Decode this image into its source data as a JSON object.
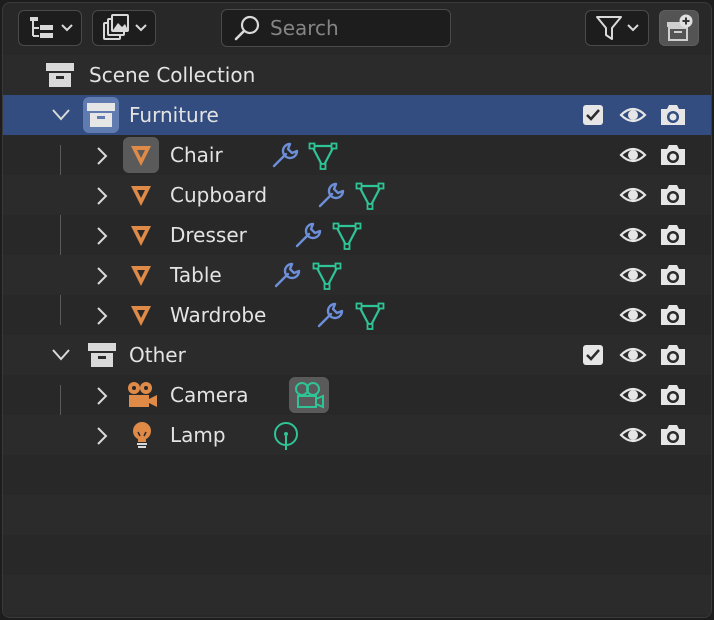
{
  "header": {
    "search_placeholder": "Search",
    "icons": [
      "outliner-display-mode-icon",
      "view-layer-icon",
      "funnel-icon",
      "new-collection-icon"
    ]
  },
  "rows": [
    {
      "label": "Scene Collection",
      "icon": "collection-box-icon"
    },
    {
      "label": "Furniture",
      "icon": "collection-box-icon",
      "selected": true,
      "checkbox": true
    },
    {
      "label": "Chair",
      "icon": "mesh-object-icon",
      "modifiers": [
        "wrench-icon",
        "mesh-data-icon"
      ],
      "active": true
    },
    {
      "label": "Cupboard",
      "icon": "mesh-object-icon",
      "modifiers": [
        "wrench-icon",
        "mesh-data-icon"
      ]
    },
    {
      "label": "Dresser",
      "icon": "mesh-object-icon",
      "modifiers": [
        "wrench-icon",
        "mesh-data-icon"
      ]
    },
    {
      "label": "Table",
      "icon": "mesh-object-icon",
      "modifiers": [
        "wrench-icon",
        "mesh-data-icon"
      ]
    },
    {
      "label": "Wardrobe",
      "icon": "mesh-object-icon",
      "modifiers": [
        "wrench-icon",
        "mesh-data-icon"
      ]
    },
    {
      "label": "Other",
      "icon": "collection-box-icon",
      "checkbox": true
    },
    {
      "label": "Camera",
      "icon": "camera-object-icon",
      "modifiers": [
        "camera-data-icon"
      ]
    },
    {
      "label": "Lamp",
      "icon": "light-object-icon",
      "modifiers": [
        "light-data-icon"
      ]
    }
  ],
  "colors": {
    "background": "#282828",
    "selected_row": "#334d80",
    "object_orange": "#e08a48",
    "modifier_blue": "#6d8ed8",
    "data_green": "#2fc496"
  }
}
